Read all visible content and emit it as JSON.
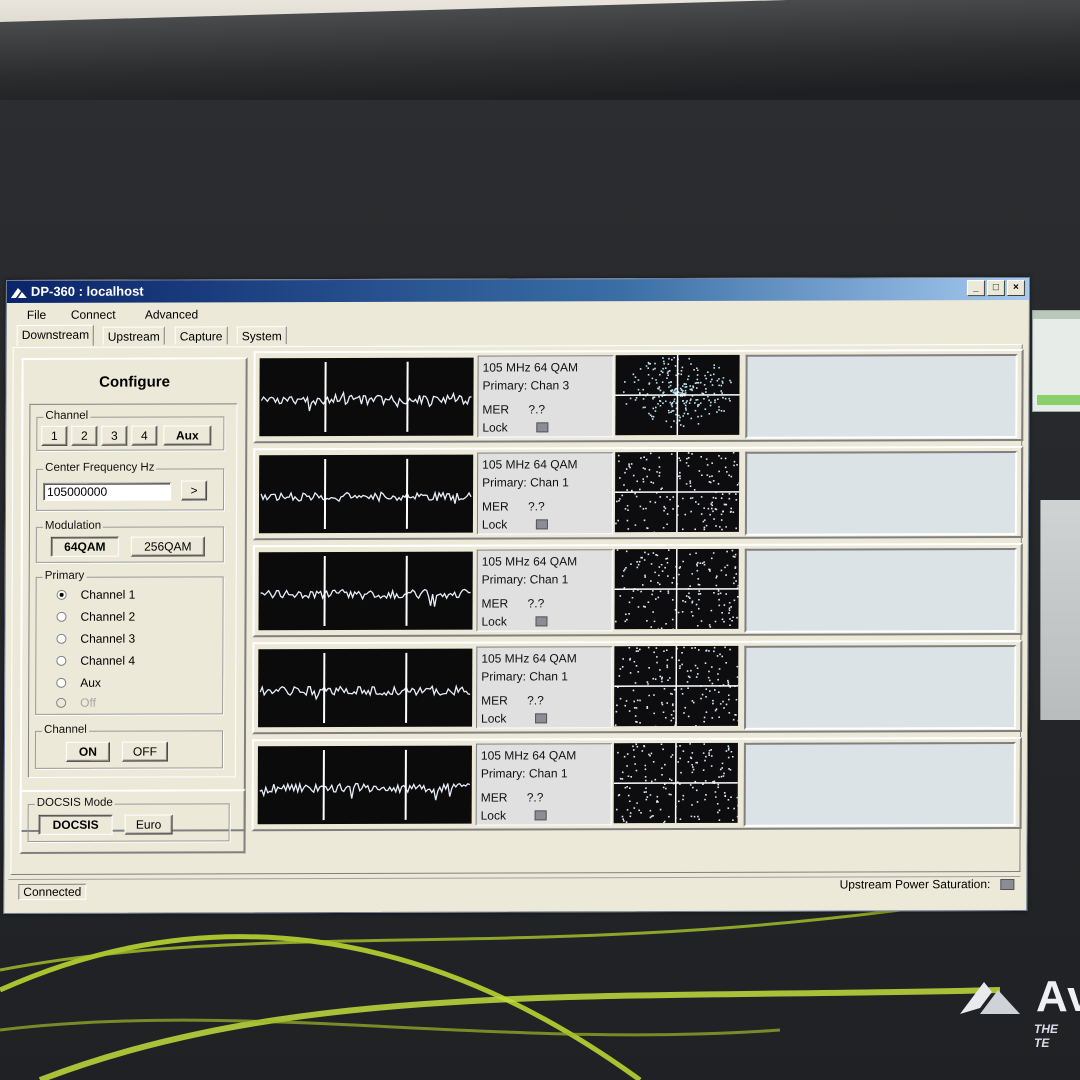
{
  "window": {
    "title": "DP-360 : localhost",
    "controls": {
      "minimize": "_",
      "maximize": "□",
      "close": "×"
    }
  },
  "menu": [
    "File",
    "Connect",
    "Advanced"
  ],
  "tabs": [
    {
      "label": "Downstream",
      "active": true
    },
    {
      "label": "Upstream",
      "active": false
    },
    {
      "label": "Capture",
      "active": false
    },
    {
      "label": "System",
      "active": false
    }
  ],
  "configure": {
    "title": "Configure",
    "channel_group": {
      "label": "Channel",
      "buttons": [
        "1",
        "2",
        "3",
        "4",
        "Aux"
      ]
    },
    "center_freq": {
      "label": "Center Frequency Hz",
      "value": "105000000",
      "go": ">"
    },
    "modulation": {
      "label": "Modulation",
      "options": [
        "64QAM",
        "256QAM"
      ],
      "selected": "64QAM"
    },
    "primary": {
      "label": "Primary",
      "options": [
        {
          "label": "Channel 1",
          "checked": true,
          "disabled": false
        },
        {
          "label": "Channel 2",
          "checked": false,
          "disabled": false
        },
        {
          "label": "Channel 3",
          "checked": false,
          "disabled": false
        },
        {
          "label": "Channel 4",
          "checked": false,
          "disabled": false
        },
        {
          "label": "Aux",
          "checked": false,
          "disabled": false
        },
        {
          "label": "Off",
          "checked": false,
          "disabled": true
        }
      ]
    },
    "channel_power": {
      "label": "Channel",
      "on": "ON",
      "off": "OFF"
    },
    "docsis": {
      "label": "DOCSIS Mode",
      "docsis": "DOCSIS",
      "euro": "Euro"
    }
  },
  "channels": [
    {
      "freq": "105 MHz  64 QAM",
      "primary": "Primary: Chan 3",
      "mer_label": "MER",
      "mer_value": "?.?",
      "lock_label": "Lock"
    },
    {
      "freq": "105 MHz  64 QAM",
      "primary": "Primary: Chan 1",
      "mer_label": "MER",
      "mer_value": "?.?",
      "lock_label": "Lock"
    },
    {
      "freq": "105 MHz  64 QAM",
      "primary": "Primary: Chan 1",
      "mer_label": "MER",
      "mer_value": "?.?",
      "lock_label": "Lock"
    },
    {
      "freq": "105 MHz  64 QAM",
      "primary": "Primary: Chan 1",
      "mer_label": "MER",
      "mer_value": "?.?",
      "lock_label": "Lock"
    },
    {
      "freq": "105 MHz  64 QAM",
      "primary": "Primary: Chan 1",
      "mer_label": "MER",
      "mer_value": "?.?",
      "lock_label": "Lock"
    }
  ],
  "status": {
    "left": "Connected",
    "right": "Upstream Power Saturation:"
  },
  "brand": {
    "text": "Av",
    "tagline": "THE TE"
  },
  "colors": {
    "title_start": "#0a246a",
    "title_end": "#a6caf0",
    "face": "#ece9d8",
    "trace": "#e8eef8",
    "swoosh": "#b8d432"
  }
}
